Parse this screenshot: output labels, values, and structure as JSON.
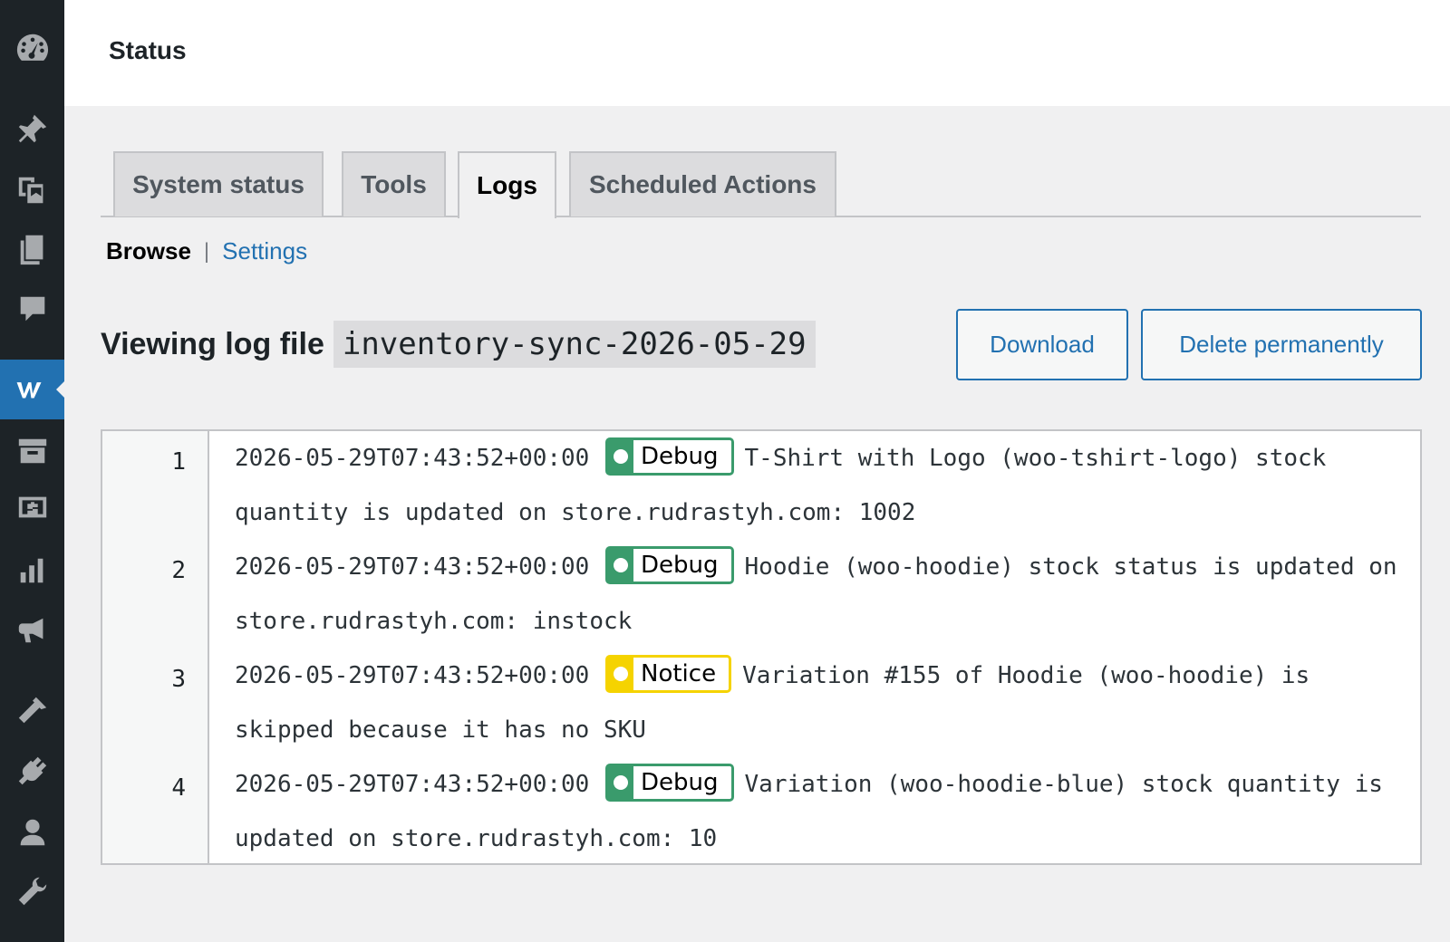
{
  "sidebar": {
    "items": [
      {
        "icon": "dashboard-icon",
        "active": false
      },
      {
        "icon": "pin-icon",
        "active": false
      },
      {
        "icon": "media-icon",
        "active": false
      },
      {
        "icon": "pages-icon",
        "active": false
      },
      {
        "icon": "comments-icon",
        "active": false
      },
      {
        "icon": "woocommerce-icon",
        "active": true
      },
      {
        "icon": "products-icon",
        "active": false
      },
      {
        "icon": "payments-icon",
        "active": false
      },
      {
        "icon": "analytics-icon",
        "active": false
      },
      {
        "icon": "marketing-icon",
        "active": false
      },
      {
        "icon": "appearance-icon",
        "active": false
      },
      {
        "icon": "plugins-icon",
        "active": false
      },
      {
        "icon": "users-icon",
        "active": false
      },
      {
        "icon": "tools-icon",
        "active": false
      }
    ]
  },
  "header": {
    "title": "Status"
  },
  "tabs": [
    {
      "label": "System status",
      "active": false
    },
    {
      "label": "Tools",
      "active": false
    },
    {
      "label": "Logs",
      "active": true
    },
    {
      "label": "Scheduled Actions",
      "active": false
    }
  ],
  "subnav": {
    "browse": "Browse",
    "separator": "|",
    "settings": "Settings"
  },
  "viewer": {
    "label": "Viewing log file",
    "file": "inventory-sync-2026-05-29",
    "download_label": "Download",
    "delete_label": "Delete permanently"
  },
  "log_lines": [
    {
      "number": "1",
      "timestamp": "2026-05-29T07:43:52+00:00",
      "level": "Debug",
      "message": "T-Shirt with Logo (woo-tshirt-logo) stock quantity is updated on store.rudrastyh.com: 1002"
    },
    {
      "number": "2",
      "timestamp": "2026-05-29T07:43:52+00:00",
      "level": "Debug",
      "message": "Hoodie (woo-hoodie) stock status is updated on store.rudrastyh.com: instock"
    },
    {
      "number": "3",
      "timestamp": "2026-05-29T07:43:52+00:00",
      "level": "Notice",
      "message": "Variation #155 of Hoodie (woo-hoodie) is skipped because it has no SKU"
    },
    {
      "number": "4",
      "timestamp": "2026-05-29T07:43:52+00:00",
      "level": "Debug",
      "message": "Variation (woo-hoodie-blue) stock quantity is updated on store.rudrastyh.com: 10"
    }
  ],
  "colors": {
    "sidebar_bg": "#1d2327",
    "accent": "#2271b1",
    "debug": "#3a9b6c",
    "notice": "#f5d300"
  }
}
